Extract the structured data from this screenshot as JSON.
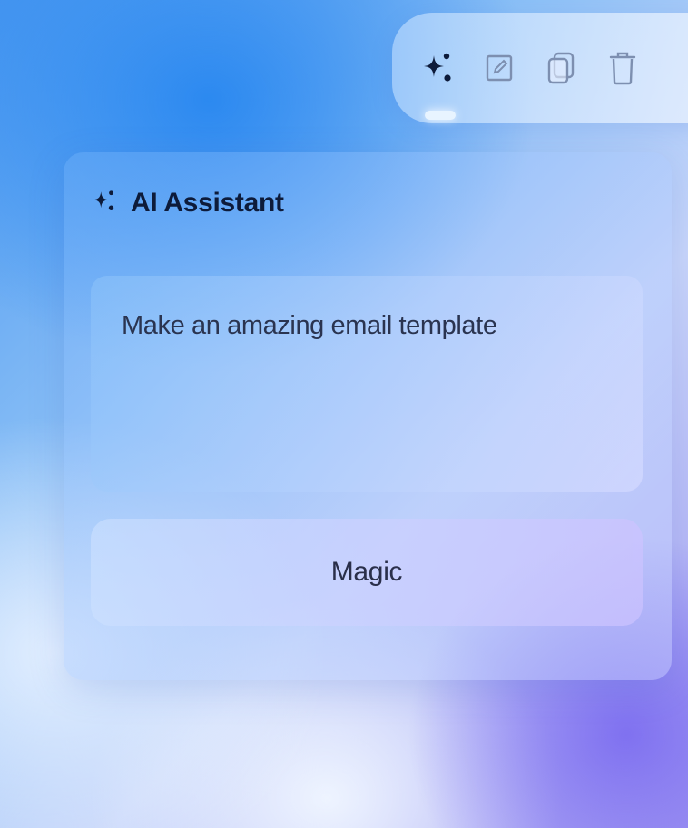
{
  "toolbar": {
    "items": [
      {
        "icon": "sparkles-icon",
        "active": true
      },
      {
        "icon": "edit-icon",
        "active": false
      },
      {
        "icon": "copy-icon",
        "active": false
      },
      {
        "icon": "trash-icon",
        "active": false
      }
    ]
  },
  "assistant": {
    "title": "AI Assistant",
    "prompt_value": "Make an amazing email template",
    "submit_label": "Magic"
  },
  "colors": {
    "text_dark": "#0d1b3a",
    "icon_active": "#0d1b3a",
    "icon_muted": "#7d8fb0"
  }
}
